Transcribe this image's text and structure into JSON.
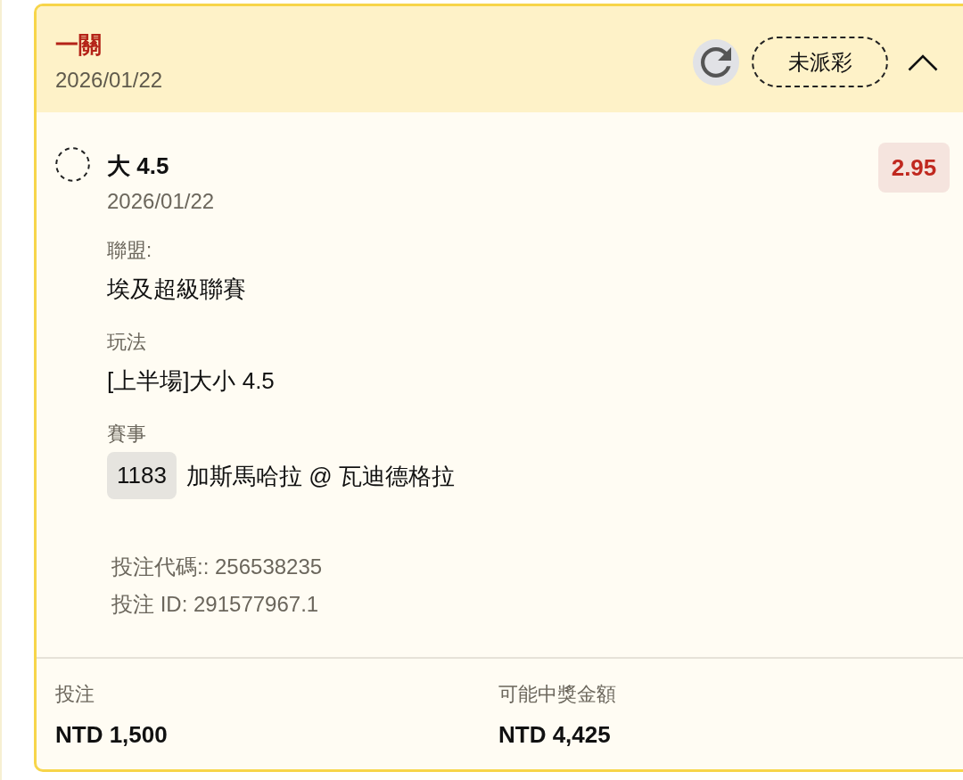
{
  "header": {
    "title": "一關",
    "date": "2026/01/22",
    "status": "未派彩",
    "expanded": true
  },
  "selection": {
    "pick": "大 4.5",
    "date": "2026/01/22",
    "odds": "2.95",
    "fields": [
      {
        "label": "聯盟:",
        "value": "埃及超級聯賽"
      },
      {
        "label": "玩法",
        "value": "[上半場]大小 4.5"
      },
      {
        "label": "賽事",
        "match_no": "1183",
        "value": "加斯馬哈拉 @ 瓦迪德格拉"
      }
    ],
    "bet_code": "投注代碼:: 256538235",
    "bet_id": "投注 ID: 291577967.1"
  },
  "footer": [
    {
      "label": "投注",
      "value": "NTD 1,500"
    },
    {
      "label": "可能中獎金額",
      "value": "NTD 4,425"
    }
  ]
}
